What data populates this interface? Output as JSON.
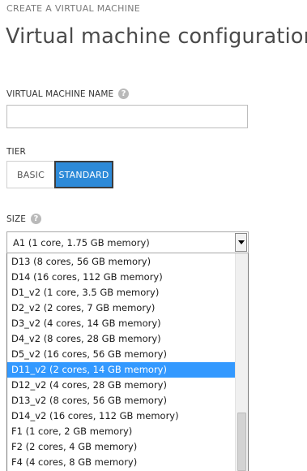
{
  "header": {
    "eyebrow": "CREATE A VIRTUAL MACHINE",
    "title": "Virtual machine configuration"
  },
  "vm_name": {
    "label": "VIRTUAL MACHINE NAME",
    "help_icon": "question-circle-icon",
    "value": ""
  },
  "tier": {
    "label": "TIER",
    "options": [
      "BASIC",
      "STANDARD"
    ],
    "selected": "STANDARD"
  },
  "size": {
    "label": "SIZE",
    "help_icon": "question-circle-icon",
    "selected_value": "A1 (1 core, 1.75 GB memory)",
    "options": [
      "D13 (8 cores, 56 GB memory)",
      "D14 (16 cores, 112 GB memory)",
      "D1_v2 (1 core, 3.5 GB memory)",
      "D2_v2 (2 cores, 7 GB memory)",
      "D3_v2 (4 cores, 14 GB memory)",
      "D4_v2 (8 cores, 28 GB memory)",
      "D5_v2 (16 cores, 56 GB memory)",
      "D11_v2 (2 cores, 14 GB memory)",
      "D12_v2 (4 cores, 28 GB memory)",
      "D13_v2 (8 cores, 56 GB memory)",
      "D14_v2 (16 cores, 112 GB memory)",
      "F1 (1 core, 2 GB memory)",
      "F2 (2 cores, 4 GB memory)",
      "F4 (4 cores, 8 GB memory)"
    ],
    "highlighted_option": "D11_v2 (2 cores, 14 GB memory)"
  },
  "colors": {
    "accent": "#2d8ad8",
    "highlight": "#3399ff"
  }
}
